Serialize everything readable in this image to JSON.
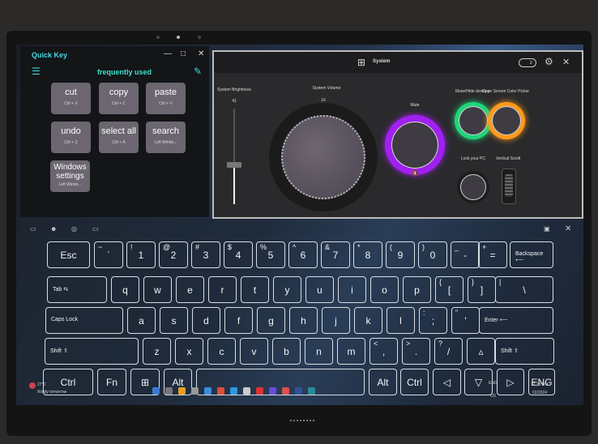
{
  "quick_key": {
    "title": "Quick Key",
    "section": "frequently used",
    "controls": {
      "minimize": "—",
      "maximize": "□",
      "close": "✕"
    },
    "buttons": [
      {
        "label": "cut",
        "shortcut": "Ctrl + X"
      },
      {
        "label": "copy",
        "shortcut": "Ctrl + C"
      },
      {
        "label": "paste",
        "shortcut": "Ctrl + V"
      },
      {
        "label": "undo",
        "shortcut": "Ctrl + Z"
      },
      {
        "label": "select all",
        "shortcut": "Ctrl + A"
      },
      {
        "label": "search",
        "shortcut": "Left Windo..."
      },
      {
        "label": "Windows settings",
        "shortcut": "Left Windo..."
      }
    ]
  },
  "system": {
    "title": "System",
    "toggle_value": "2",
    "close": "✕",
    "brightness": {
      "label": "System Brightness",
      "value": 41
    },
    "volume": {
      "label": "System Volume",
      "value": 16
    },
    "mute": {
      "label": "Mute"
    },
    "show_hide": {
      "label": "Show/Hide desktop"
    },
    "color_picker": {
      "label": "Open Screen Color Picker"
    },
    "lock": {
      "label": "Lock your PC"
    },
    "scroll": {
      "label": "Vertical Scroll"
    },
    "colors": {
      "mute": "#a020f0",
      "show_hide": "#1ed67a",
      "color_picker": "#ff9a1a"
    }
  },
  "keyboard": {
    "rows": [
      [
        {
          "m": "Esc"
        },
        {
          "t": "~",
          "m": "`"
        },
        {
          "t": "!",
          "m": "1"
        },
        {
          "t": "@",
          "m": "2"
        },
        {
          "t": "#",
          "m": "3"
        },
        {
          "t": "$",
          "m": "4"
        },
        {
          "t": "%",
          "m": "5"
        },
        {
          "t": "^",
          "m": "6"
        },
        {
          "t": "&",
          "m": "7"
        },
        {
          "t": "*",
          "m": "8"
        },
        {
          "t": "(",
          "m": "9"
        },
        {
          "t": ")",
          "m": "0"
        },
        {
          "t": "_",
          "m": "-"
        },
        {
          "t": "+",
          "m": "="
        },
        {
          "w": "Backspace ⟵"
        }
      ],
      [
        {
          "w": "Tab ⇆"
        },
        {
          "m": "q"
        },
        {
          "m": "w"
        },
        {
          "m": "e"
        },
        {
          "m": "r"
        },
        {
          "m": "t"
        },
        {
          "m": "y"
        },
        {
          "m": "u"
        },
        {
          "m": "i"
        },
        {
          "m": "o"
        },
        {
          "m": "p"
        },
        {
          "t": "{",
          "m": "["
        },
        {
          "t": "}",
          "m": "]"
        },
        {
          "t": "|",
          "m": "\\"
        }
      ],
      [
        {
          "w": "Caps Lock"
        },
        {
          "m": "a"
        },
        {
          "m": "s"
        },
        {
          "m": "d"
        },
        {
          "m": "f"
        },
        {
          "m": "g"
        },
        {
          "m": "h"
        },
        {
          "m": "j"
        },
        {
          "m": "k"
        },
        {
          "m": "l"
        },
        {
          "t": ":",
          "m": ";"
        },
        {
          "t": "\"",
          "m": "'"
        },
        {
          "w": "Enter ⟵"
        }
      ],
      [
        {
          "w": "Shift ⇧"
        },
        {
          "m": "z"
        },
        {
          "m": "x"
        },
        {
          "m": "c"
        },
        {
          "m": "v"
        },
        {
          "m": "b"
        },
        {
          "m": "n"
        },
        {
          "m": "m"
        },
        {
          "t": "<",
          "m": ","
        },
        {
          "t": ">",
          "m": "."
        },
        {
          "t": "?",
          "m": "/"
        },
        {
          "m": "▵"
        },
        {
          "w": "Shift ⇧"
        }
      ],
      [
        {
          "m": "Ctrl"
        },
        {
          "m": "Fn"
        },
        {
          "m": "⊞"
        },
        {
          "m": "Alt"
        },
        {
          "m": ""
        },
        {
          "m": "Alt"
        },
        {
          "m": "Ctrl"
        },
        {
          "m": "◁"
        },
        {
          "m": "▽"
        },
        {
          "m": "▷"
        },
        {
          "m": "ENG"
        }
      ]
    ]
  },
  "taskbar": {
    "weather_temp": "27°C",
    "weather_text": "Windy tomorrow",
    "lang": "ENG",
    "lang_sub": "US",
    "time": "12:18 PM",
    "date": "02/2024"
  }
}
